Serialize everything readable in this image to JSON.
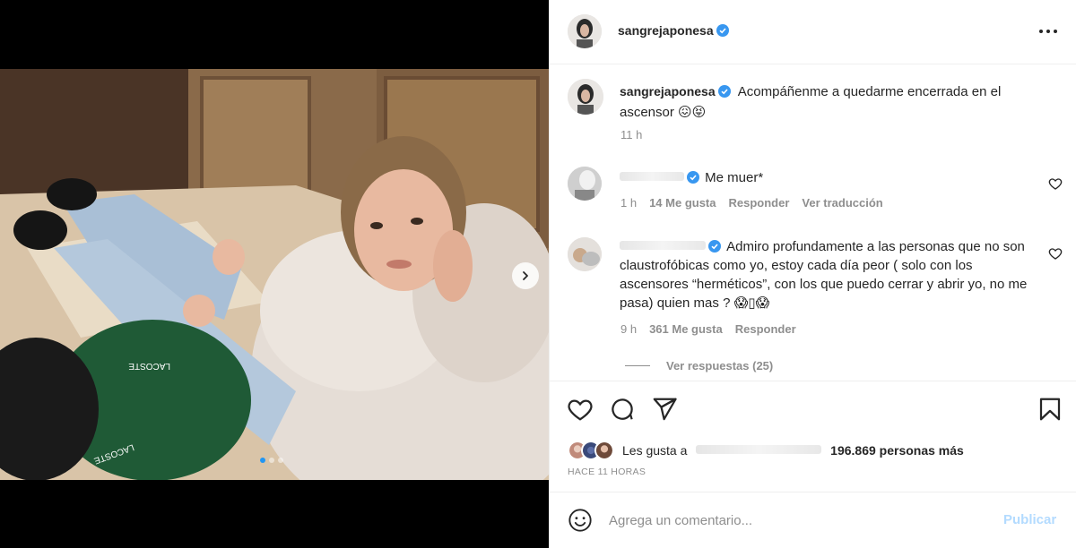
{
  "post": {
    "username": "sangrejaponesa",
    "caption": "Acompáñenme a quedarme encerrada en el ascensor 😖😝",
    "caption_time": "11 h",
    "photo_bag_text": "LACOSTE"
  },
  "comments": [
    {
      "text": "Me muer*",
      "time": "1 h",
      "likes": "14 Me gusta",
      "reply": "Responder",
      "translate": "Ver traducción"
    },
    {
      "text": "Admiro profundamente a las personas que no son claustrofóbicas como yo, estoy cada día peor ( solo con los ascensores “herméticos”, con los que puedo cerrar y abrir yo, no me pasa) quien mas ? 😱▯😱",
      "time": "9 h",
      "likes": "361 Me gusta",
      "reply": "Responder"
    }
  ],
  "view_replies": "Ver respuestas (25)",
  "likes": {
    "prefix": "Les gusta a",
    "count_text": "196.869 personas más"
  },
  "post_age": "HACE 11 HORAS",
  "comment_box": {
    "placeholder": "Agrega un comentario...",
    "publish_label": "Publicar"
  },
  "colors": {
    "verified": "#3897f0",
    "publish_disabled": "#b3dbff",
    "carousel_dot_active": "#2196f3"
  },
  "icons": [
    "more-options-icon",
    "verified-badge-icon",
    "heart-icon",
    "comment-icon",
    "share-icon",
    "bookmark-icon",
    "emoji-icon",
    "chevron-right-icon"
  ]
}
